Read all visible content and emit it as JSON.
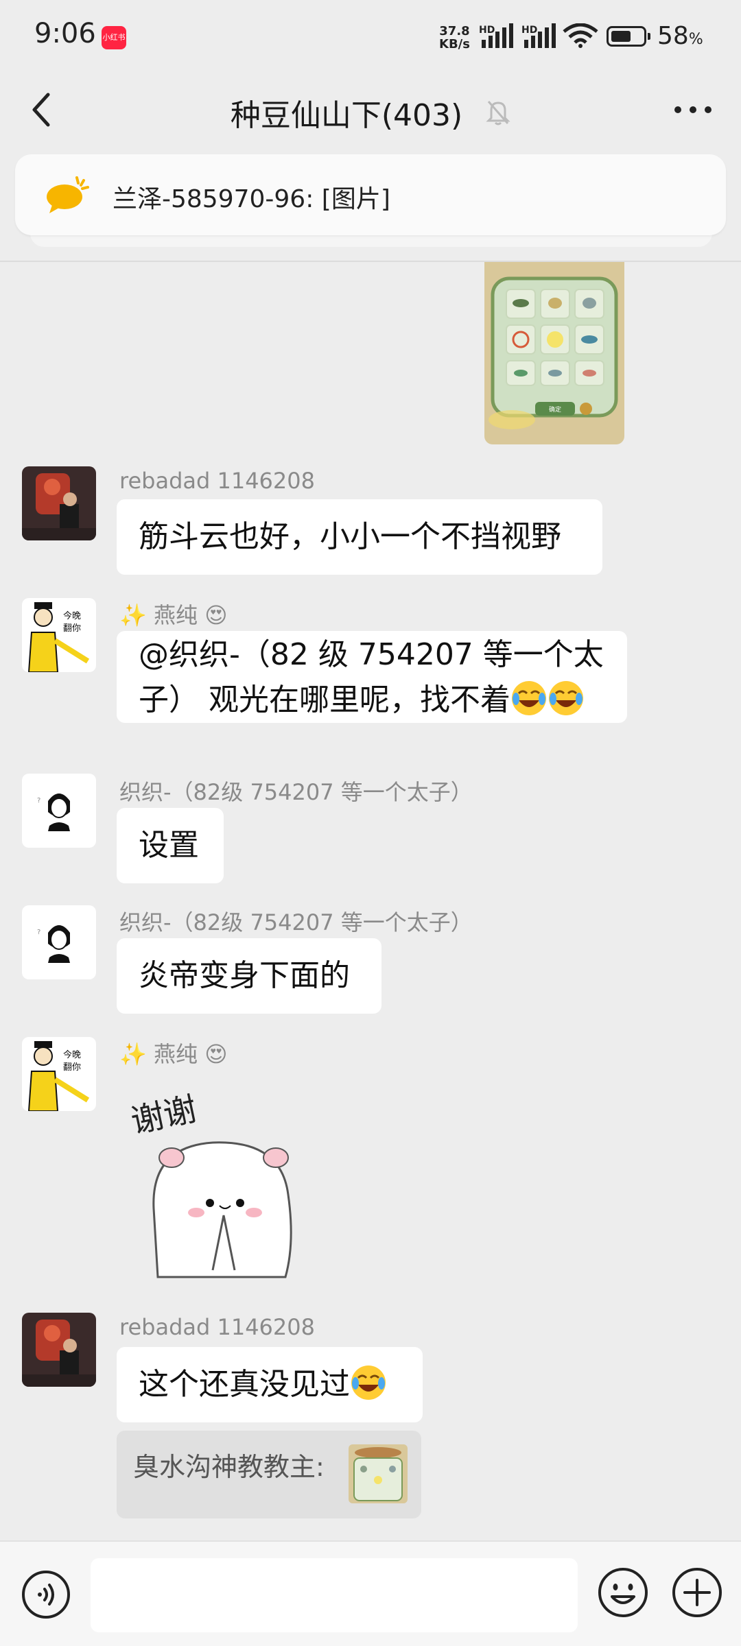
{
  "status_bar": {
    "time": "9:06",
    "app_badge": "小红书",
    "net_speed_value": "37.8",
    "net_speed_unit": "KB/s",
    "hd1": "HD",
    "hd2": "HD",
    "battery_percent": "58",
    "battery_unit": "%"
  },
  "nav": {
    "title": "种豆仙山下(403)"
  },
  "notice": {
    "text": "兰泽-585970-96: [图片]"
  },
  "messages": [
    {
      "sender": "rebadad 1146208",
      "text": "筋斗云也好，小小一个不挡视野"
    },
    {
      "sender_prefix": "✨",
      "sender": "燕纯",
      "sender_suffix": "😍",
      "text_line1": "@织织-（82 级 754207 等一个太",
      "text_line2": "子） 观光在哪里呢，找不着"
    },
    {
      "sender": "织织-（82级 754207 等一个太子）",
      "text": "设置"
    },
    {
      "sender": "织织-（82级 754207 等一个太子）",
      "text": "炎帝变身下面的"
    },
    {
      "sender_prefix": "✨",
      "sender": "燕纯",
      "sender_suffix": "😍",
      "sticker_text": "谢谢"
    },
    {
      "sender": "rebadad 1146208",
      "text": "这个还真没见过",
      "quote": "臭水沟神教教主:"
    }
  ],
  "image_msg": {
    "button_label": "确定"
  },
  "input": {
    "placeholder": ""
  },
  "colors": {
    "background": "#ededed",
    "bubble": "#ffffff",
    "accent_badge": "#ff2442"
  }
}
